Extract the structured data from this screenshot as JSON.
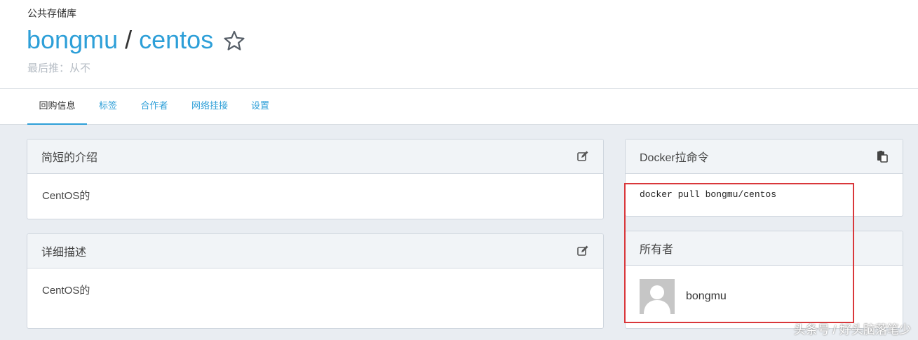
{
  "header": {
    "repo_type": "公共存储库",
    "namespace": "bongmu",
    "separator": "/",
    "repo_name": "centos",
    "last_push": "最后推：从不"
  },
  "tabs": [
    {
      "label": "回购信息",
      "active": true
    },
    {
      "label": "标签"
    },
    {
      "label": "合作者"
    },
    {
      "label": "网络挂接"
    },
    {
      "label": "设置"
    }
  ],
  "short_description": {
    "title": "简短的介绍",
    "text": "CentOS的"
  },
  "full_description": {
    "title": "详细描述",
    "text": "CentOS的"
  },
  "pull_command": {
    "title": "Docker拉命令",
    "command": "docker pull bongmu/centos"
  },
  "owner": {
    "title": "所有者",
    "name": "bongmu"
  },
  "watermark": "头条号 / 好头脑落笔少",
  "colors": {
    "accent": "#2d9fd8",
    "highlight": "#d9373b",
    "background": "#e9edf2"
  },
  "icons": [
    "star-icon",
    "edit-icon",
    "clipboard-icon",
    "avatar-placeholder-icon"
  ]
}
